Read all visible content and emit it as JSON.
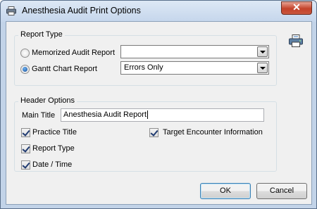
{
  "window": {
    "title": "Anesthesia Audit Print Options",
    "close_symbol": "✕"
  },
  "report_type": {
    "group_label": "Report Type",
    "options": [
      {
        "label": "Memorized Audit Report",
        "selected": false,
        "combo_value": ""
      },
      {
        "label": "Gantt Chart Report",
        "selected": true,
        "combo_value": "Errors Only"
      }
    ]
  },
  "header_options": {
    "group_label": "Header Options",
    "main_title_label": "Main Title",
    "main_title_value": "Anesthesia Audit Report",
    "checkboxes": [
      {
        "label": "Practice Title",
        "checked": true
      },
      {
        "label": "Report Type",
        "checked": true
      },
      {
        "label": "Date / Time",
        "checked": true
      },
      {
        "label": "Target Encounter Information",
        "checked": true
      }
    ]
  },
  "buttons": {
    "ok": "OK",
    "cancel": "Cancel"
  },
  "icons": {
    "title": "printer-icon",
    "print": "printer-icon"
  }
}
